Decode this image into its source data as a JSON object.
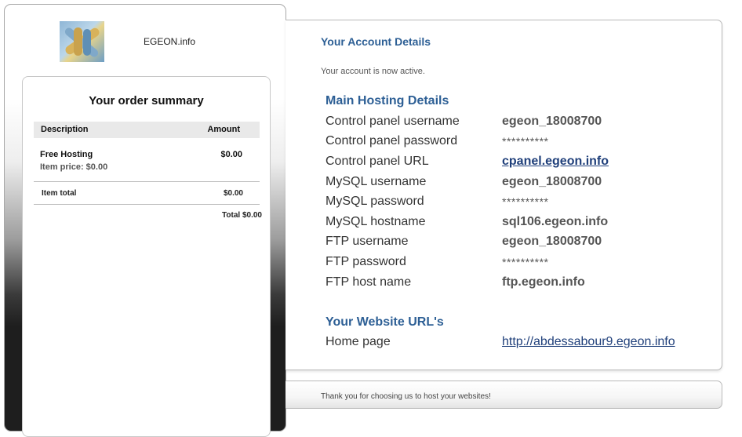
{
  "sidebar": {
    "site_name": "EGEON.info",
    "logo_icon": "hands-circle-logo"
  },
  "order": {
    "title": "Your order summary",
    "col_description": "Description",
    "col_amount": "Amount",
    "item_name": "Free Hosting",
    "item_price": "Item price: $0.00",
    "item_amount": "$0.00",
    "item_total_label": "Item total",
    "item_total_value": "$0.00",
    "total_line": "Total $0.00"
  },
  "account": {
    "title": "Your Account Details",
    "status": "Your account is now active.",
    "hosting_title": "Main Hosting Details",
    "rows": [
      {
        "label": "Control panel username",
        "value": "egeon_18008700"
      },
      {
        "label": "Control panel password",
        "value": "**********"
      },
      {
        "label": "Control panel URL",
        "value": "cpanel.egeon.info"
      },
      {
        "label": "MySQL username",
        "value": "egeon_18008700"
      },
      {
        "label": "MySQL password",
        "value": "**********"
      },
      {
        "label": "MySQL hostname",
        "value": "sql106.egeon.info"
      },
      {
        "label": "FTP username",
        "value": "egeon_18008700"
      },
      {
        "label": "FTP password",
        "value": "**********"
      },
      {
        "label": "FTP host name",
        "value": "ftp.egeon.info"
      }
    ],
    "website_title": "Your Website URL's",
    "home_label": "Home page",
    "home_url": "http://abdessabour9.egeon.info"
  },
  "footer": {
    "text": "Thank you for choosing us to host your websites!"
  },
  "colors": {
    "heading_blue": "#2d5f95",
    "link_blue": "#1f3f7a"
  }
}
